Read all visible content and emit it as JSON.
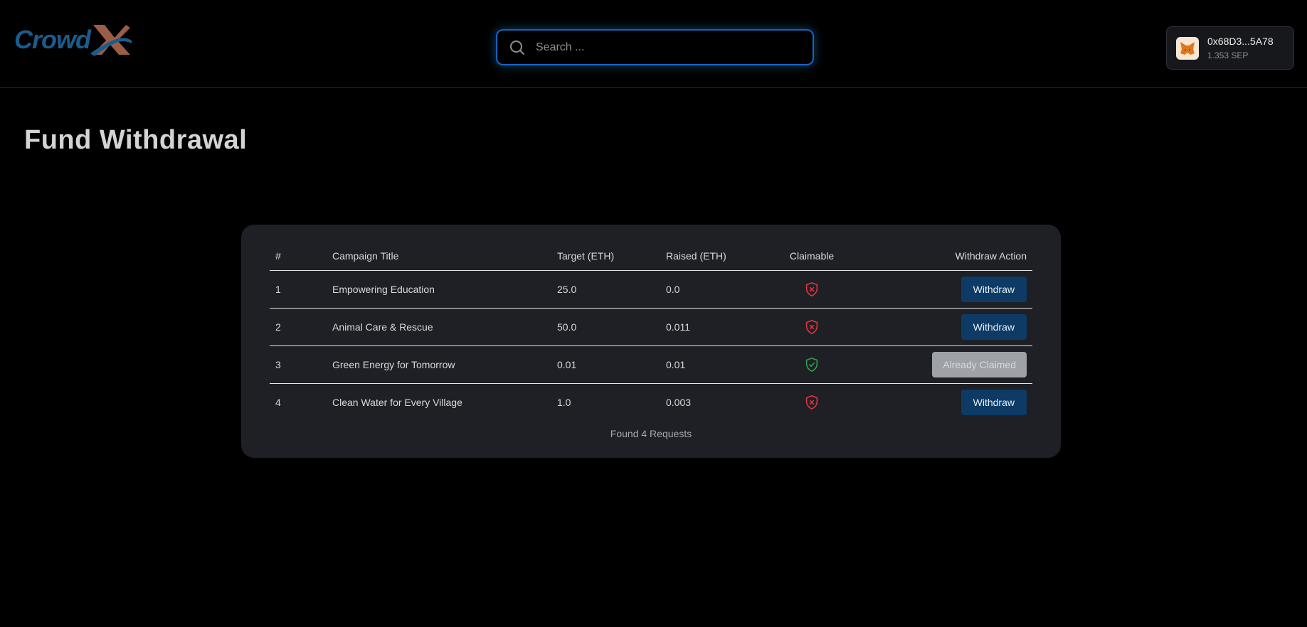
{
  "header": {
    "logo_text": "Crowd",
    "search_placeholder": "Search ...",
    "wallet": {
      "address": "0x68D3...5A78",
      "balance": "1.353 SEP"
    }
  },
  "page_title": "Fund Withdrawal",
  "table": {
    "columns": [
      "#",
      "Campaign Title",
      "Target (ETH)",
      "Raised (ETH)",
      "Claimable",
      "Withdraw Action"
    ],
    "rows": [
      {
        "num": "1",
        "title": "Empowering Education",
        "target": "25.0",
        "raised": "0.0",
        "claimable": "shield-x-icon",
        "action": "Withdraw"
      },
      {
        "num": "2",
        "title": "Animal Care & Rescue",
        "target": "50.0",
        "raised": "0.011",
        "claimable": "shield-x-icon",
        "action": "Withdraw"
      },
      {
        "num": "3",
        "title": "Green Energy for Tomorrow",
        "target": "0.01",
        "raised": "0.01",
        "claimable": "shield-check-icon",
        "action": "Already Claimed"
      },
      {
        "num": "4",
        "title": "Clean Water for Every Village",
        "target": "1.0",
        "raised": "0.003",
        "claimable": "shield-x-icon",
        "action": "Withdraw"
      }
    ],
    "footer": "Found 4 Requests"
  },
  "colors": {
    "accent": "#1565c0",
    "button": "#0d3b66",
    "disabled_button": "#9ea1a7",
    "shield_red": "#d9363e",
    "shield_green": "#2e9e4a",
    "logo_blue": "#1b5c8c",
    "logo_brown": "#9b5d47"
  }
}
